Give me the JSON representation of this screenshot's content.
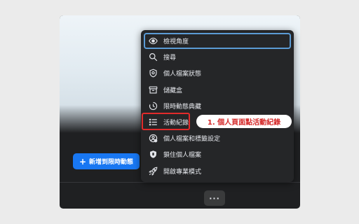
{
  "menu": {
    "items": [
      {
        "label": "檢視角度",
        "icon": "eye-icon"
      },
      {
        "label": "搜尋",
        "icon": "search-icon"
      },
      {
        "label": "個人檔案狀態",
        "icon": "shield-status-icon"
      },
      {
        "label": "儲藏盒",
        "icon": "archive-box-icon"
      },
      {
        "label": "限時動態典藏",
        "icon": "clock-history-icon"
      },
      {
        "label": "活動紀錄",
        "icon": "list-icon"
      },
      {
        "label": "個人檔案和標籤設定",
        "icon": "profile-gear-icon"
      },
      {
        "label": "鎖住個人檔案",
        "icon": "shield-lock-icon"
      },
      {
        "label": "開啟專業模式",
        "icon": "rocket-icon"
      }
    ]
  },
  "story_button": {
    "label": "新增到限時動態"
  },
  "more_button": {
    "label": "···"
  },
  "callout": {
    "label": "1. 個人頁面點活動紀錄"
  },
  "colors": {
    "accent": "#1877f2",
    "highlight_red": "#e12b2b",
    "menu_bg": "#252628",
    "selected_outline": "#5b9bd5"
  }
}
